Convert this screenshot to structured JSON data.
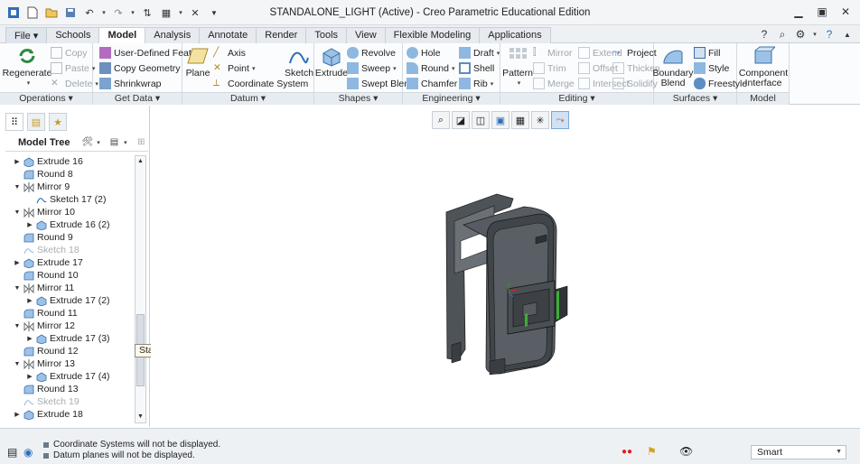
{
  "window": {
    "title": "STANDALONE_LIGHT (Active) - Creo Parametric Educational Edition"
  },
  "tabs": [
    {
      "label": "File ▾",
      "id": "file"
    },
    {
      "label": "Schools",
      "id": "schools"
    },
    {
      "label": "Model",
      "id": "model",
      "active": true
    },
    {
      "label": "Analysis",
      "id": "analysis"
    },
    {
      "label": "Annotate",
      "id": "annotate"
    },
    {
      "label": "Render",
      "id": "render"
    },
    {
      "label": "Tools",
      "id": "tools"
    },
    {
      "label": "View",
      "id": "view"
    },
    {
      "label": "Flexible Modeling",
      "id": "flexible-modeling"
    },
    {
      "label": "Applications",
      "id": "applications"
    }
  ],
  "ribbon": {
    "operations": {
      "label": "Operations ▾",
      "regenerate": "Regenerate",
      "copy": "Copy",
      "paste": "Paste",
      "delete": "Delete"
    },
    "getdata": {
      "label": "Get Data ▾",
      "udf": "User-Defined Feature",
      "copygeom": "Copy Geometry",
      "shrinkwrap": "Shrinkwrap"
    },
    "datum": {
      "label": "Datum ▾",
      "plane": "Plane",
      "axis": "Axis",
      "point": "Point",
      "csys": "Coordinate System",
      "sketch": "Sketch"
    },
    "shapes": {
      "label": "Shapes ▾",
      "extrude": "Extrude",
      "revolve": "Revolve",
      "sweep": "Sweep",
      "sweptblend": "Swept Blend"
    },
    "engineering": {
      "label": "Engineering ▾",
      "hole": "Hole",
      "round": "Round",
      "chamfer": "Chamfer",
      "draft": "Draft",
      "shell": "Shell",
      "rib": "Rib"
    },
    "editing": {
      "label": "Editing ▾",
      "pattern": "Pattern",
      "mirror": "Mirror",
      "trim": "Trim",
      "merge": "Merge",
      "extend": "Extend",
      "offset": "Offset",
      "intersect": "Intersect",
      "project": "Project",
      "thicken": "Thicken",
      "solidify": "Solidify"
    },
    "surfaces": {
      "label": "Surfaces ▾",
      "boundary": "Boundary Blend",
      "fill": "Fill",
      "style": "Style",
      "freestyle": "Freestyle"
    },
    "intent": {
      "label": "Model Intent ▾",
      "component": "Component Interface"
    }
  },
  "model_tree": {
    "title": "Model Tree",
    "items": [
      {
        "label": "Extrude 16",
        "indent": 0,
        "expander": "▶",
        "icon": "extrude",
        "dim": false
      },
      {
        "label": "Round 8",
        "indent": 0,
        "expander": "",
        "icon": "round",
        "dim": false
      },
      {
        "label": "Mirror 9",
        "indent": 0,
        "expander": "▼",
        "icon": "mirror",
        "dim": false
      },
      {
        "label": "Sketch 17 (2)",
        "indent": 1,
        "expander": "",
        "icon": "sketch",
        "dim": false
      },
      {
        "label": "Mirror 10",
        "indent": 0,
        "expander": "▼",
        "icon": "mirror",
        "dim": false
      },
      {
        "label": "Extrude 16 (2)",
        "indent": 1,
        "expander": "▶",
        "icon": "extrude",
        "dim": false
      },
      {
        "label": "Round 9",
        "indent": 0,
        "expander": "",
        "icon": "round",
        "dim": false
      },
      {
        "label": "Sketch 18",
        "indent": 0,
        "expander": "",
        "icon": "sketch",
        "dim": true
      },
      {
        "label": "Extrude 17",
        "indent": 0,
        "expander": "▶",
        "icon": "extrude",
        "dim": false
      },
      {
        "label": "Round 10",
        "indent": 0,
        "expander": "",
        "icon": "round",
        "dim": false
      },
      {
        "label": "Mirror 11",
        "indent": 0,
        "expander": "▼",
        "icon": "mirror",
        "dim": false
      },
      {
        "label": "Extrude 17 (2)",
        "indent": 1,
        "expander": "▶",
        "icon": "extrude",
        "dim": false
      },
      {
        "label": "Round 11",
        "indent": 0,
        "expander": "",
        "icon": "round",
        "dim": false
      },
      {
        "label": "Mirror 12",
        "indent": 0,
        "expander": "▼",
        "icon": "mirror",
        "dim": false
      },
      {
        "label": "Extrude 17 (3)",
        "indent": 1,
        "expander": "▶",
        "icon": "extrude",
        "dim": false
      },
      {
        "label": "Round 12",
        "indent": 0,
        "expander": "",
        "icon": "round",
        "dim": false
      },
      {
        "label": "Mirror 13",
        "indent": 0,
        "expander": "▼",
        "icon": "mirror",
        "dim": false
      },
      {
        "label": "Extrude 17 (4)",
        "indent": 1,
        "expander": "▶",
        "icon": "extrude",
        "dim": false
      },
      {
        "label": "Round 13",
        "indent": 0,
        "expander": "",
        "icon": "round",
        "dim": false
      },
      {
        "label": "Sketch 19",
        "indent": 0,
        "expander": "",
        "icon": "sketch",
        "dim": true
      },
      {
        "label": "Extrude 18",
        "indent": 0,
        "expander": "▶",
        "icon": "extrude",
        "dim": false
      }
    ]
  },
  "tooltip": "Start Capture",
  "status": {
    "messages": [
      "Coordinate Systems will not be displayed.",
      "Datum planes will not be displayed."
    ],
    "filter": "Smart"
  },
  "colors": {
    "model_gray": "#4e5358",
    "accent_blue": "#2f6fb7",
    "status_red": "#e02020"
  }
}
